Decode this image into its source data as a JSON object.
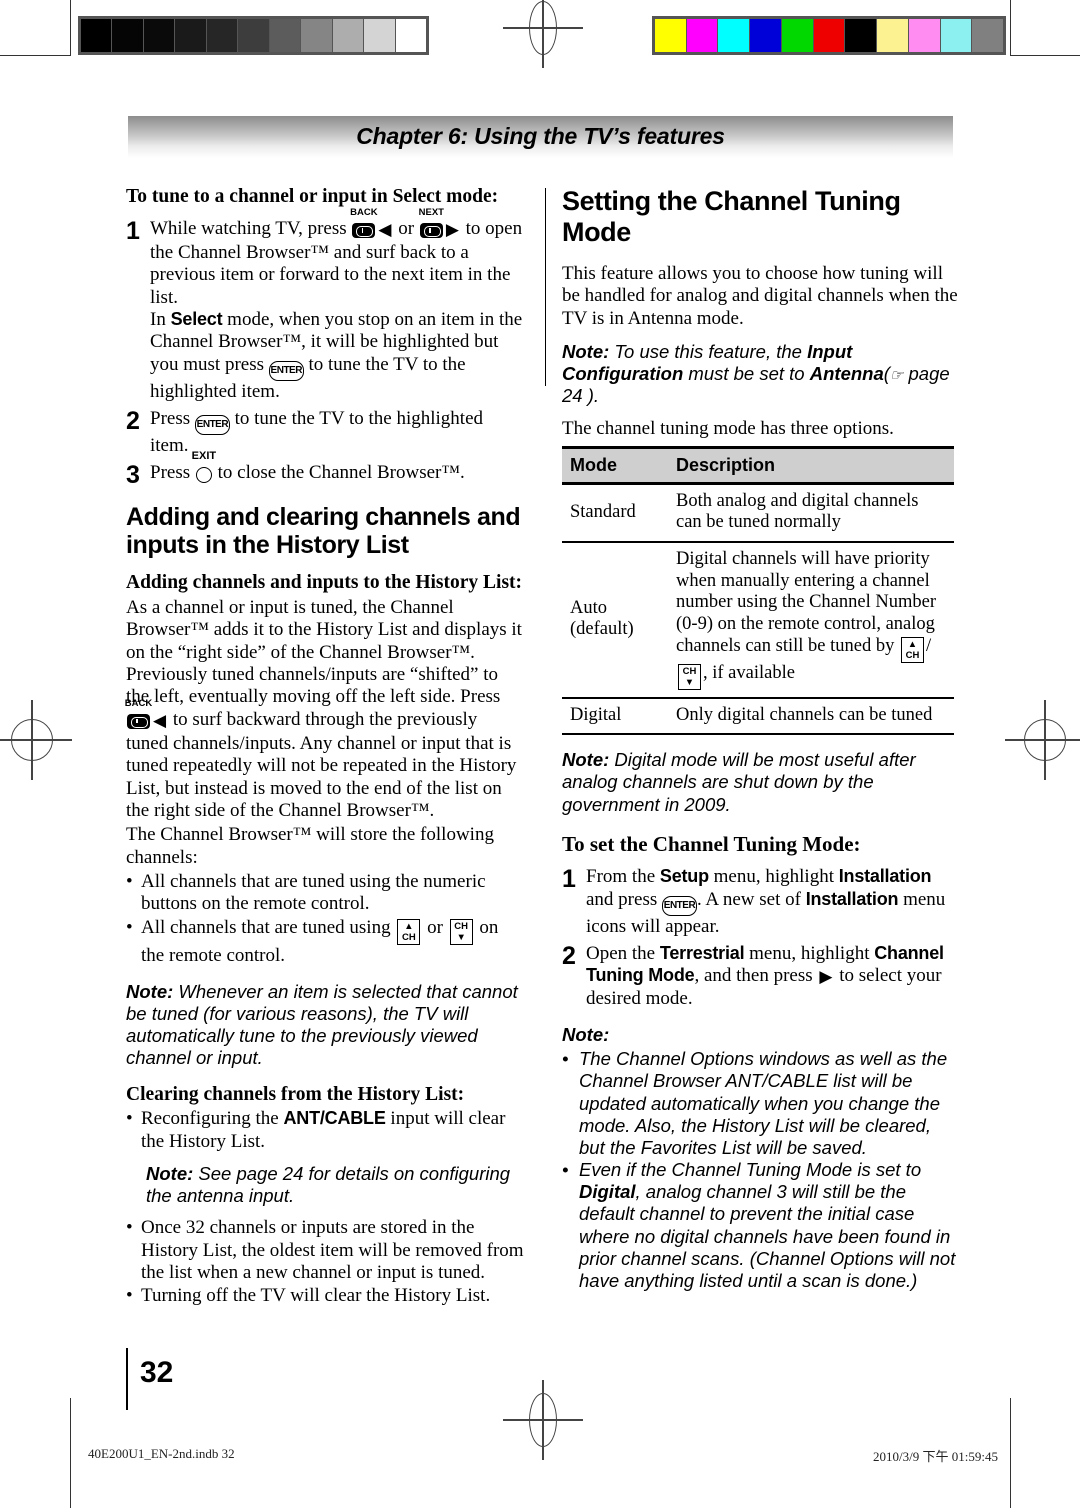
{
  "print_marks": {
    "grayscale_steps": [
      "#000000",
      "#050505",
      "#0a0a0a",
      "#1a1a1a",
      "#262626",
      "#3d3d3d",
      "#5c5c5c",
      "#858585",
      "#adadad",
      "#d4d4d4",
      "#ffffff"
    ],
    "color_patches": [
      "#ffff00",
      "#ff00ff",
      "#00ffff",
      "#0000d8",
      "#00d800",
      "#ee0000",
      "#000000",
      "#fcf291",
      "#ff8cf0",
      "#8cf0f0",
      "#808080"
    ]
  },
  "header": {
    "chapter": "Chapter 6: Using the TV’s features"
  },
  "left_column": {
    "heading1": "To tune to a channel or input in Select mode:",
    "step1_a": "While watching TV, press",
    "step1_back_cap": "BACK",
    "step1_or": "or",
    "step1_next_cap": "NEXT",
    "step1_b": "to open the Channel Browser™ and surf back to a previous item or forward to the next item in the list.",
    "step1_c_pre": "In",
    "step1_c_select": "Select",
    "step1_c_mid": "mode, when you stop on an item in the Channel Browser™, it will be highlighted but you must press",
    "step1_enter": "ENTER",
    "step1_c_end": "to tune the TV to the highlighted item.",
    "step2_pre": "Press",
    "step2_end": "to tune the TV to the highlighted item.",
    "step3_pre": "Press",
    "step3_exit_cap": "EXIT",
    "step3_end": "to close the Channel Browser™.",
    "heading2": "Adding and clearing channels and inputs in the History List",
    "heading3": "Adding channels and inputs to the History List:",
    "para1": "As a channel or input is tuned, the Channel Browser™ adds it to the History List and displays it on the “right side” of the Channel Browser™. Previously tuned channels/inputs are “shifted” to the left, eventually moving off the left side. Press",
    "para1_back_cap": "BACK",
    "para1_cont": "to surf backward through the previously tuned channels/inputs. Any channel or input that is tuned repeatedly will not be repeated in the History List, but instead is moved to the end of the list on the right side of the Channel Browser™.",
    "para2": "The Channel Browser™ will store the following channels:",
    "bullet1": "All channels that are tuned using the numeric buttons on the remote control.",
    "bullet2_pre": "All channels that are tuned using",
    "bullet2_or": "or",
    "bullet2_end": "on the remote control.",
    "note1_label": "Note:",
    "note1_text": "Whenever an item is selected that cannot be tuned (for various reasons), the TV will automatically tune to the previously viewed channel or input.",
    "heading4": "Clearing channels from the History List:",
    "bullet3_pre": "Reconfiguring the",
    "bullet3_bold": "ANT/CABLE",
    "bullet3_end": "input will clear the History List.",
    "note2_label": "Note:",
    "note2_text": "See page 24 for details on configuring the antenna input.",
    "bullet4": "Once 32 channels or inputs are stored in the History List, the oldest item will be removed from the list when a new channel or input is tuned.",
    "bullet5": "Turning off the TV will clear the History List."
  },
  "right_column": {
    "heading1": "Setting the Channel Tuning Mode",
    "para1": "This feature allows you to choose how tuning will be handled for analog and digital channels when the TV is in Antenna mode.",
    "note1_label": "Note:",
    "note1_a": "To use this feature, the",
    "note1_bold1": "Input Configuration",
    "note1_b": "must be set to",
    "note1_bold2": "Antenna",
    "note1_c": "(",
    "note1_page": "page 24",
    "note1_d": ").",
    "para2": "The channel tuning mode has three options.",
    "table": {
      "columns": [
        "Mode",
        "Description"
      ],
      "rows": [
        {
          "mode": "Standard",
          "description": "Both analog and digital channels can be tuned normally"
        },
        {
          "mode": "Auto (default)",
          "description_a": "Digital channels will have priority when manually entering a channel number using the Channel Number (0-9) on the remote control, analog channels can still be tuned by",
          "description_b": "/",
          "description_c": ", if available"
        },
        {
          "mode": "Digital",
          "description": "Only digital channels can be tuned"
        }
      ]
    },
    "note2_label": "Note:",
    "note2_text": "Digital mode will be most useful after analog channels are shut down by the government in 2009.",
    "heading2": "To set the Channel Tuning Mode:",
    "step1_a": "From the",
    "step1_setup": "Setup",
    "step1_b": "menu, highlight",
    "step1_install": "Installation",
    "step1_c": "and press",
    "step1_enter": "ENTER",
    "step1_d": ". A new set of",
    "step1_install2": "Installation",
    "step1_e": "menu icons will appear.",
    "step2_a": "Open the",
    "step2_terrestrial": "Terrestrial",
    "step2_b": "menu, highlight",
    "step2_mode": "Channel Tuning Mode",
    "step2_c": ", and then press",
    "step2_d": "to select your desired mode.",
    "note3_label": "Note:",
    "note3_bullet1": "The Channel Options windows as well as the Channel Browser ANT/CABLE list will be updated automatically when you change the mode. Also, the History List will be cleared, but the Favorites List will be saved.",
    "note3_bullet2_a": "Even if the Channel Tuning Mode is set to",
    "note3_bullet2_bold": "Digital",
    "note3_bullet2_b": ", analog channel 3 will still be the default channel to prevent the initial case where no digital channels have been found in prior channel scans. (Channel Options will not have anything listed until a scan is done.)"
  },
  "footer": {
    "page_number": "32",
    "file_name": "40E200U1_EN-2nd.indb   32",
    "timestamp": "2010/3/9   下午 01:59:45"
  }
}
